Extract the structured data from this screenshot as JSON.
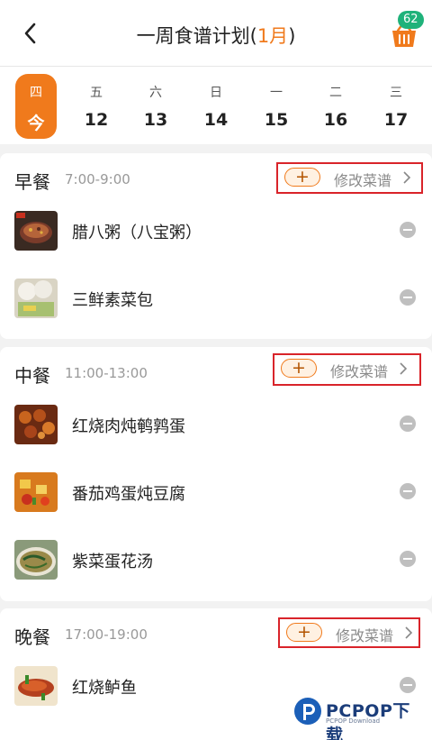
{
  "header": {
    "title_main": "一周食谱计划(",
    "title_month": "1月",
    "title_close": ")",
    "cart_count": "62"
  },
  "week": {
    "days": [
      {
        "weekday": "四",
        "date": "今",
        "active": true
      },
      {
        "weekday": "五",
        "date": "12"
      },
      {
        "weekday": "六",
        "date": "13"
      },
      {
        "weekday": "日",
        "date": "14"
      },
      {
        "weekday": "一",
        "date": "15"
      },
      {
        "weekday": "二",
        "date": "16"
      },
      {
        "weekday": "三",
        "date": "17"
      }
    ]
  },
  "meals": [
    {
      "name": "早餐",
      "time": "7:00-9:00",
      "add_label": "+",
      "edit_label": "修改菜谱",
      "dishes": [
        {
          "name": "腊八粥（八宝粥）",
          "image": "congee-photo"
        },
        {
          "name": "三鲜素菜包",
          "image": "steamed-buns-photo"
        }
      ]
    },
    {
      "name": "中餐",
      "time": "11:00-13:00",
      "add_label": "+",
      "edit_label": "修改菜谱",
      "dishes": [
        {
          "name": "红烧肉炖鹌鹑蛋",
          "image": "braised-pork-photo"
        },
        {
          "name": "番茄鸡蛋炖豆腐",
          "image": "tomato-tofu-photo"
        },
        {
          "name": "紫菜蛋花汤",
          "image": "seaweed-soup-photo"
        }
      ]
    },
    {
      "name": "晚餐",
      "time": "17:00-19:00",
      "add_label": "+",
      "edit_label": "修改菜谱",
      "dishes": [
        {
          "name": "红烧鲈鱼",
          "image": "braised-fish-photo"
        }
      ]
    }
  ],
  "watermark": {
    "brand": "PCPOP下载",
    "sub": "PCPOP Download"
  },
  "colors": {
    "accent": "#f07a1c",
    "highlight_box": "#d9242a",
    "badge": "#1fb27a"
  }
}
